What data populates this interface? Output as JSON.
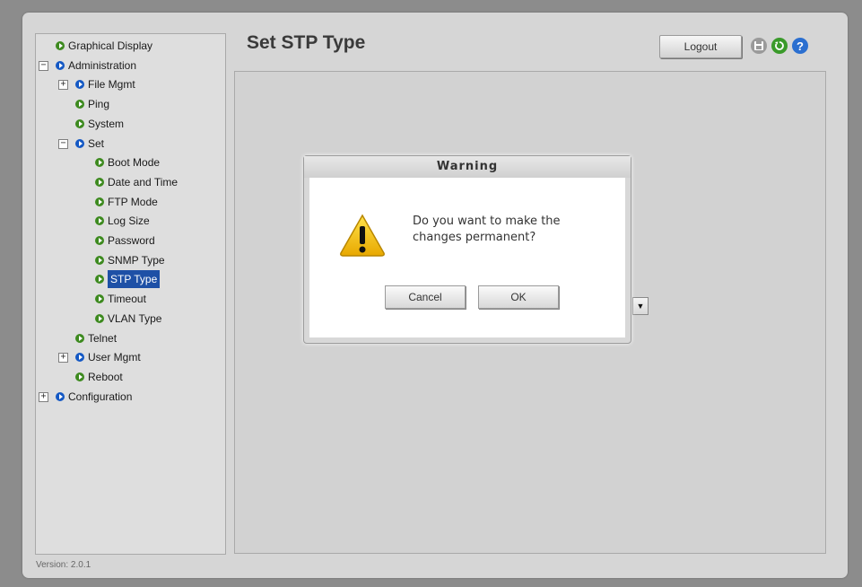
{
  "page": {
    "title": "Set STP Type",
    "version": "Version: 2.0.1"
  },
  "header": {
    "logout_label": "Logout",
    "icons": [
      "save-icon",
      "refresh-icon",
      "help-icon"
    ]
  },
  "tree": {
    "items": [
      {
        "label": "Graphical Display",
        "icon": "green"
      },
      {
        "label": "Administration",
        "icon": "blue",
        "expander": "−"
      },
      {
        "label": "File Mgmt",
        "icon": "blue",
        "expander": "+"
      },
      {
        "label": "Ping",
        "icon": "green"
      },
      {
        "label": "System",
        "icon": "green"
      },
      {
        "label": "Set",
        "icon": "blue",
        "expander": "−"
      },
      {
        "label": "Boot Mode",
        "icon": "green"
      },
      {
        "label": "Date and Time",
        "icon": "green"
      },
      {
        "label": "FTP Mode",
        "icon": "green"
      },
      {
        "label": "Log Size",
        "icon": "green"
      },
      {
        "label": "Password",
        "icon": "green"
      },
      {
        "label": "SNMP Type",
        "icon": "green"
      },
      {
        "label": "STP Type",
        "icon": "green",
        "selected": true
      },
      {
        "label": "Timeout",
        "icon": "green"
      },
      {
        "label": "VLAN Type",
        "icon": "green"
      },
      {
        "label": "Telnet",
        "icon": "green"
      },
      {
        "label": "User Mgmt",
        "icon": "blue",
        "expander": "+"
      },
      {
        "label": "Reboot",
        "icon": "green"
      },
      {
        "label": "Configuration",
        "icon": "blue",
        "expander": "+"
      }
    ]
  },
  "dialog": {
    "title": "Warning",
    "message_line1": "Do you want to make the",
    "message_line2": "changes  permanent?",
    "cancel_label": "Cancel",
    "ok_label": "OK",
    "icon": "warning-icon"
  },
  "colors": {
    "selected_bg": "#1e50a6",
    "bullet_green": "#3d8a1f",
    "bullet_blue": "#1458c4",
    "warning_yellow": "#f2c200"
  }
}
